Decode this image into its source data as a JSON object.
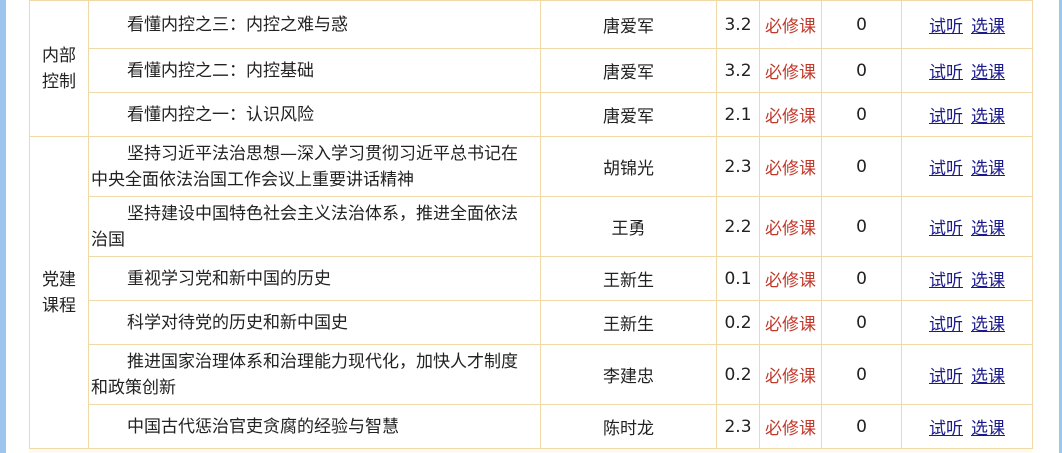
{
  "groups": [
    {
      "category": "内部控制",
      "rows": [
        {
          "title": "看懂内控之三：内控之难与惑",
          "teacher": "唐爱军",
          "credit": "3.2",
          "type": "必修课",
          "count": "0",
          "preview": "试听",
          "select": "选课"
        },
        {
          "title": "看懂内控之二：内控基础",
          "teacher": "唐爱军",
          "credit": "3.2",
          "type": "必修课",
          "count": "0",
          "preview": "试听",
          "select": "选课"
        },
        {
          "title": "看懂内控之一：认识风险",
          "teacher": "唐爱军",
          "credit": "2.1",
          "type": "必修课",
          "count": "0",
          "preview": "试听",
          "select": "选课"
        }
      ]
    },
    {
      "category": "党建课程",
      "rows": [
        {
          "title": "坚持习近平法治思想—深入学习贯彻习近平总书记在中央全面依法治国工作会议上重要讲话精神",
          "teacher": "胡锦光",
          "credit": "2.3",
          "type": "必修课",
          "count": "0",
          "preview": "试听",
          "select": "选课"
        },
        {
          "title": "坚持建设中国特色社会主义法治体系，推进全面依法治国",
          "teacher": "王勇",
          "credit": "2.2",
          "type": "必修课",
          "count": "0",
          "preview": "试听",
          "select": "选课"
        },
        {
          "title": "重视学习党和新中国的历史",
          "teacher": "王新生",
          "credit": "0.1",
          "type": "必修课",
          "count": "0",
          "preview": "试听",
          "select": "选课"
        },
        {
          "title": "科学对待党的历史和新中国史",
          "teacher": "王新生",
          "credit": "0.2",
          "type": "必修课",
          "count": "0",
          "preview": "试听",
          "select": "选课"
        },
        {
          "title": "推进国家治理体系和治理能力现代化，加快人才制度和政策创新",
          "teacher": "李建忠",
          "credit": "0.2",
          "type": "必修课",
          "count": "0",
          "preview": "试听",
          "select": "选课"
        },
        {
          "title": "中国古代惩治官吏贪腐的经验与智慧",
          "teacher": "陈时龙",
          "credit": "2.3",
          "type": "必修课",
          "count": "0",
          "preview": "试听",
          "select": "选课"
        }
      ]
    }
  ]
}
